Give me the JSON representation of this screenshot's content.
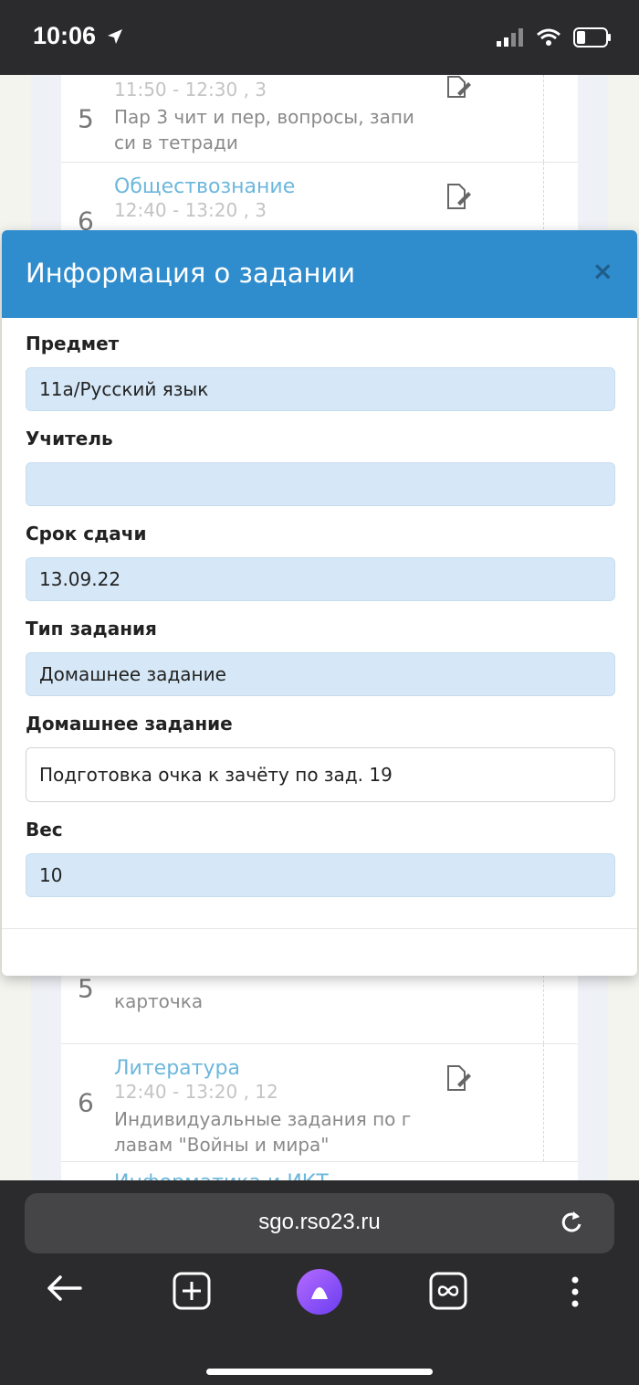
{
  "status_bar": {
    "time": "10:06"
  },
  "background_page": {
    "lessons_top": [
      {
        "num": "5",
        "subject": "",
        "time": "11:50 - 12:30 , 3",
        "homework": "Пар 3 чит и пер, вопросы, запи си в тетради"
      },
      {
        "num": "6",
        "subject": "Обществознание",
        "time": "12:40 - 13:20 , 3",
        "homework": ""
      }
    ],
    "lessons_bottom": [
      {
        "num": "5",
        "subject": "",
        "time": "",
        "homework": "карточка"
      },
      {
        "num": "6",
        "subject": "Литература",
        "time": "12:40 - 13:20 , 12",
        "homework": "Индивидуальные задания по г лавам \"Войны и мира\""
      },
      {
        "num": "",
        "subject": "Информатика и ИКТ",
        "time": "",
        "homework": ""
      }
    ]
  },
  "modal": {
    "title": "Информация о задании",
    "close": "×",
    "fields": {
      "subject": {
        "label": "Предмет",
        "value": "11а/Русский язык"
      },
      "teacher": {
        "label": "Учитель",
        "value": ""
      },
      "due": {
        "label": "Срок сдачи",
        "value": "13.09.22"
      },
      "type": {
        "label": "Тип задания",
        "value": "Домашнее задание"
      },
      "homework": {
        "label": "Домашнее задание",
        "value": "Подготовка очка к зачёту по зад. 19"
      },
      "weight": {
        "label": "Вес",
        "value": "10"
      }
    }
  },
  "browser": {
    "url": "sgo.rso23.ru"
  },
  "colors": {
    "header": "#2f8ccd",
    "field_bg": "#d6e8f7",
    "link": "#6cb7dc"
  }
}
